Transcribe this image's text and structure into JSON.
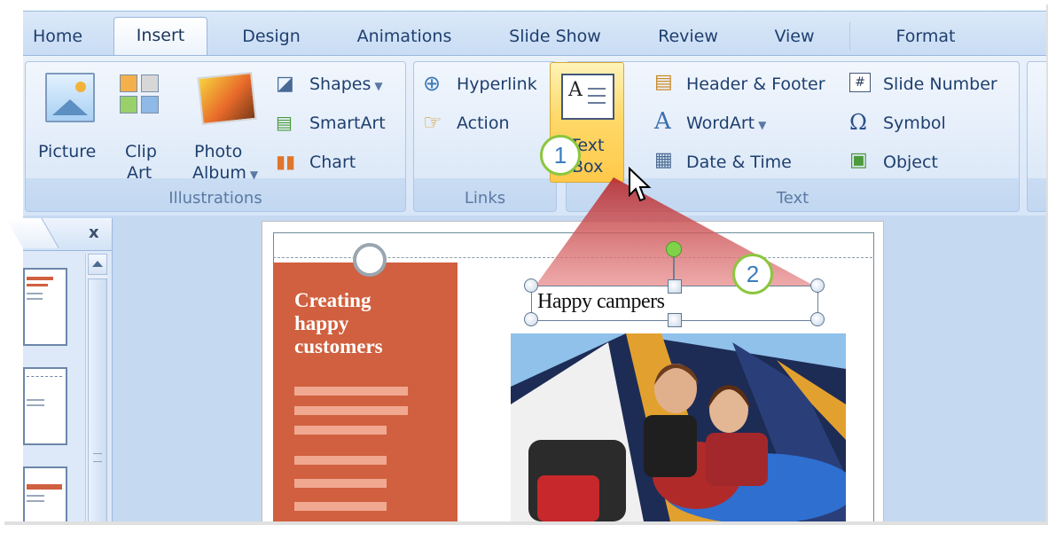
{
  "tabs": [
    "Home",
    "Insert",
    "Design",
    "Animations",
    "Slide Show",
    "Review",
    "View",
    "Format"
  ],
  "ribbon": {
    "illustrations": {
      "title": "Illustrations",
      "picture": "Picture",
      "clip_art_line1": "Clip",
      "clip_art_line2": "Art",
      "photo_album_line1": "Photo",
      "photo_album_line2": "Album",
      "shapes": "Shapes",
      "smartart": "SmartArt",
      "chart": "Chart"
    },
    "links": {
      "title": "Links",
      "hyperlink": "Hyperlink",
      "action": "Action"
    },
    "text": {
      "title": "Text",
      "text_box_line1": "Text",
      "text_box_line2": "Box",
      "header_footer": "Header & Footer",
      "wordart": "WordArt",
      "date_time": "Date & Time",
      "slide_number": "Slide Number",
      "symbol": "Symbol",
      "object": "Object"
    }
  },
  "callouts": [
    "1",
    "2"
  ],
  "slides_pane": {
    "close_label": "x"
  },
  "slide": {
    "heading": "Creating happy customers",
    "textbox_text": "Happy campers"
  },
  "colors": {
    "accent_orange": "#d0603f",
    "textbox_highlight": "#ffd96a",
    "callout_green": "#8cc63f"
  }
}
